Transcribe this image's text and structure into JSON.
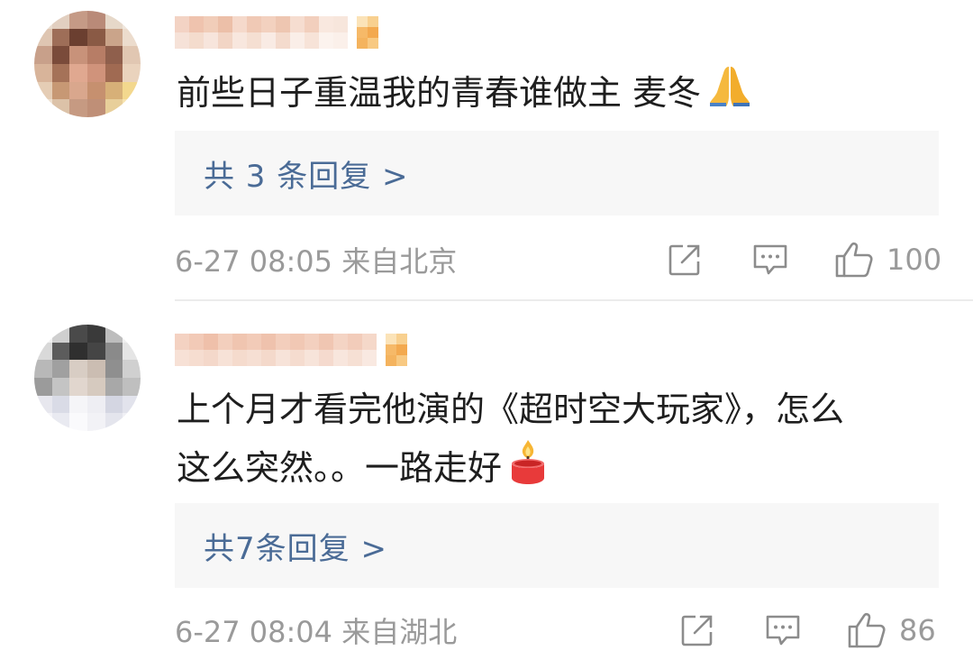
{
  "comments": [
    {
      "text": "前些日子重温我的青春谁做主 麦冬",
      "emoji": "folded-hands-icon",
      "replies_label": "共 3 条回复 >",
      "timestamp": "6-27 08:05 来自北京",
      "likes": "100"
    },
    {
      "text_line1": "上个月才看完他演的《超时空大玩家》，怎么",
      "text_line2": "这么突然。。一路走好",
      "emoji": "candle-icon",
      "replies_label": "共7条回复 >",
      "timestamp": "6-27 08:04 来自湖北",
      "likes": "86"
    }
  ],
  "colors": {
    "link": "#4a6b96",
    "meta": "#9a9a9a",
    "reply_bg": "#f7f7f7"
  }
}
